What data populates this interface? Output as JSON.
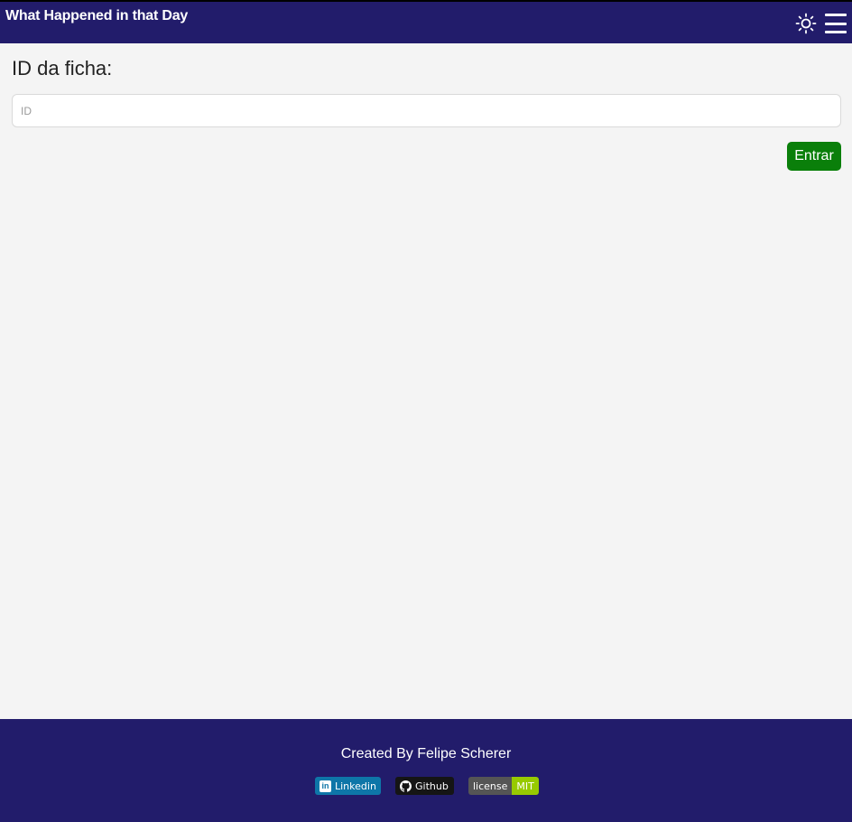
{
  "header": {
    "title": "What Happened in that Day",
    "theme_icon": "sun-icon",
    "menu_icon": "hamburger-menu-icon"
  },
  "form": {
    "label": "ID da ficha:",
    "input": {
      "placeholder": "ID",
      "value": ""
    },
    "submit_label": "Entrar"
  },
  "footer": {
    "credit": "Created By Felipe Scherer",
    "badges": [
      {
        "icon": "linkedin-icon",
        "label": "Linkedin",
        "color": "#0e76a8"
      },
      {
        "icon": "github-icon",
        "label": "Github",
        "color": "#151515"
      },
      {
        "label": "license",
        "value": "MIT",
        "label_color": "#555555",
        "value_color": "#97ca00"
      }
    ]
  },
  "colors": {
    "header_bg": "#221c6b",
    "page_bg": "#f4f4f4",
    "button_bg": "#0a7f0a"
  }
}
